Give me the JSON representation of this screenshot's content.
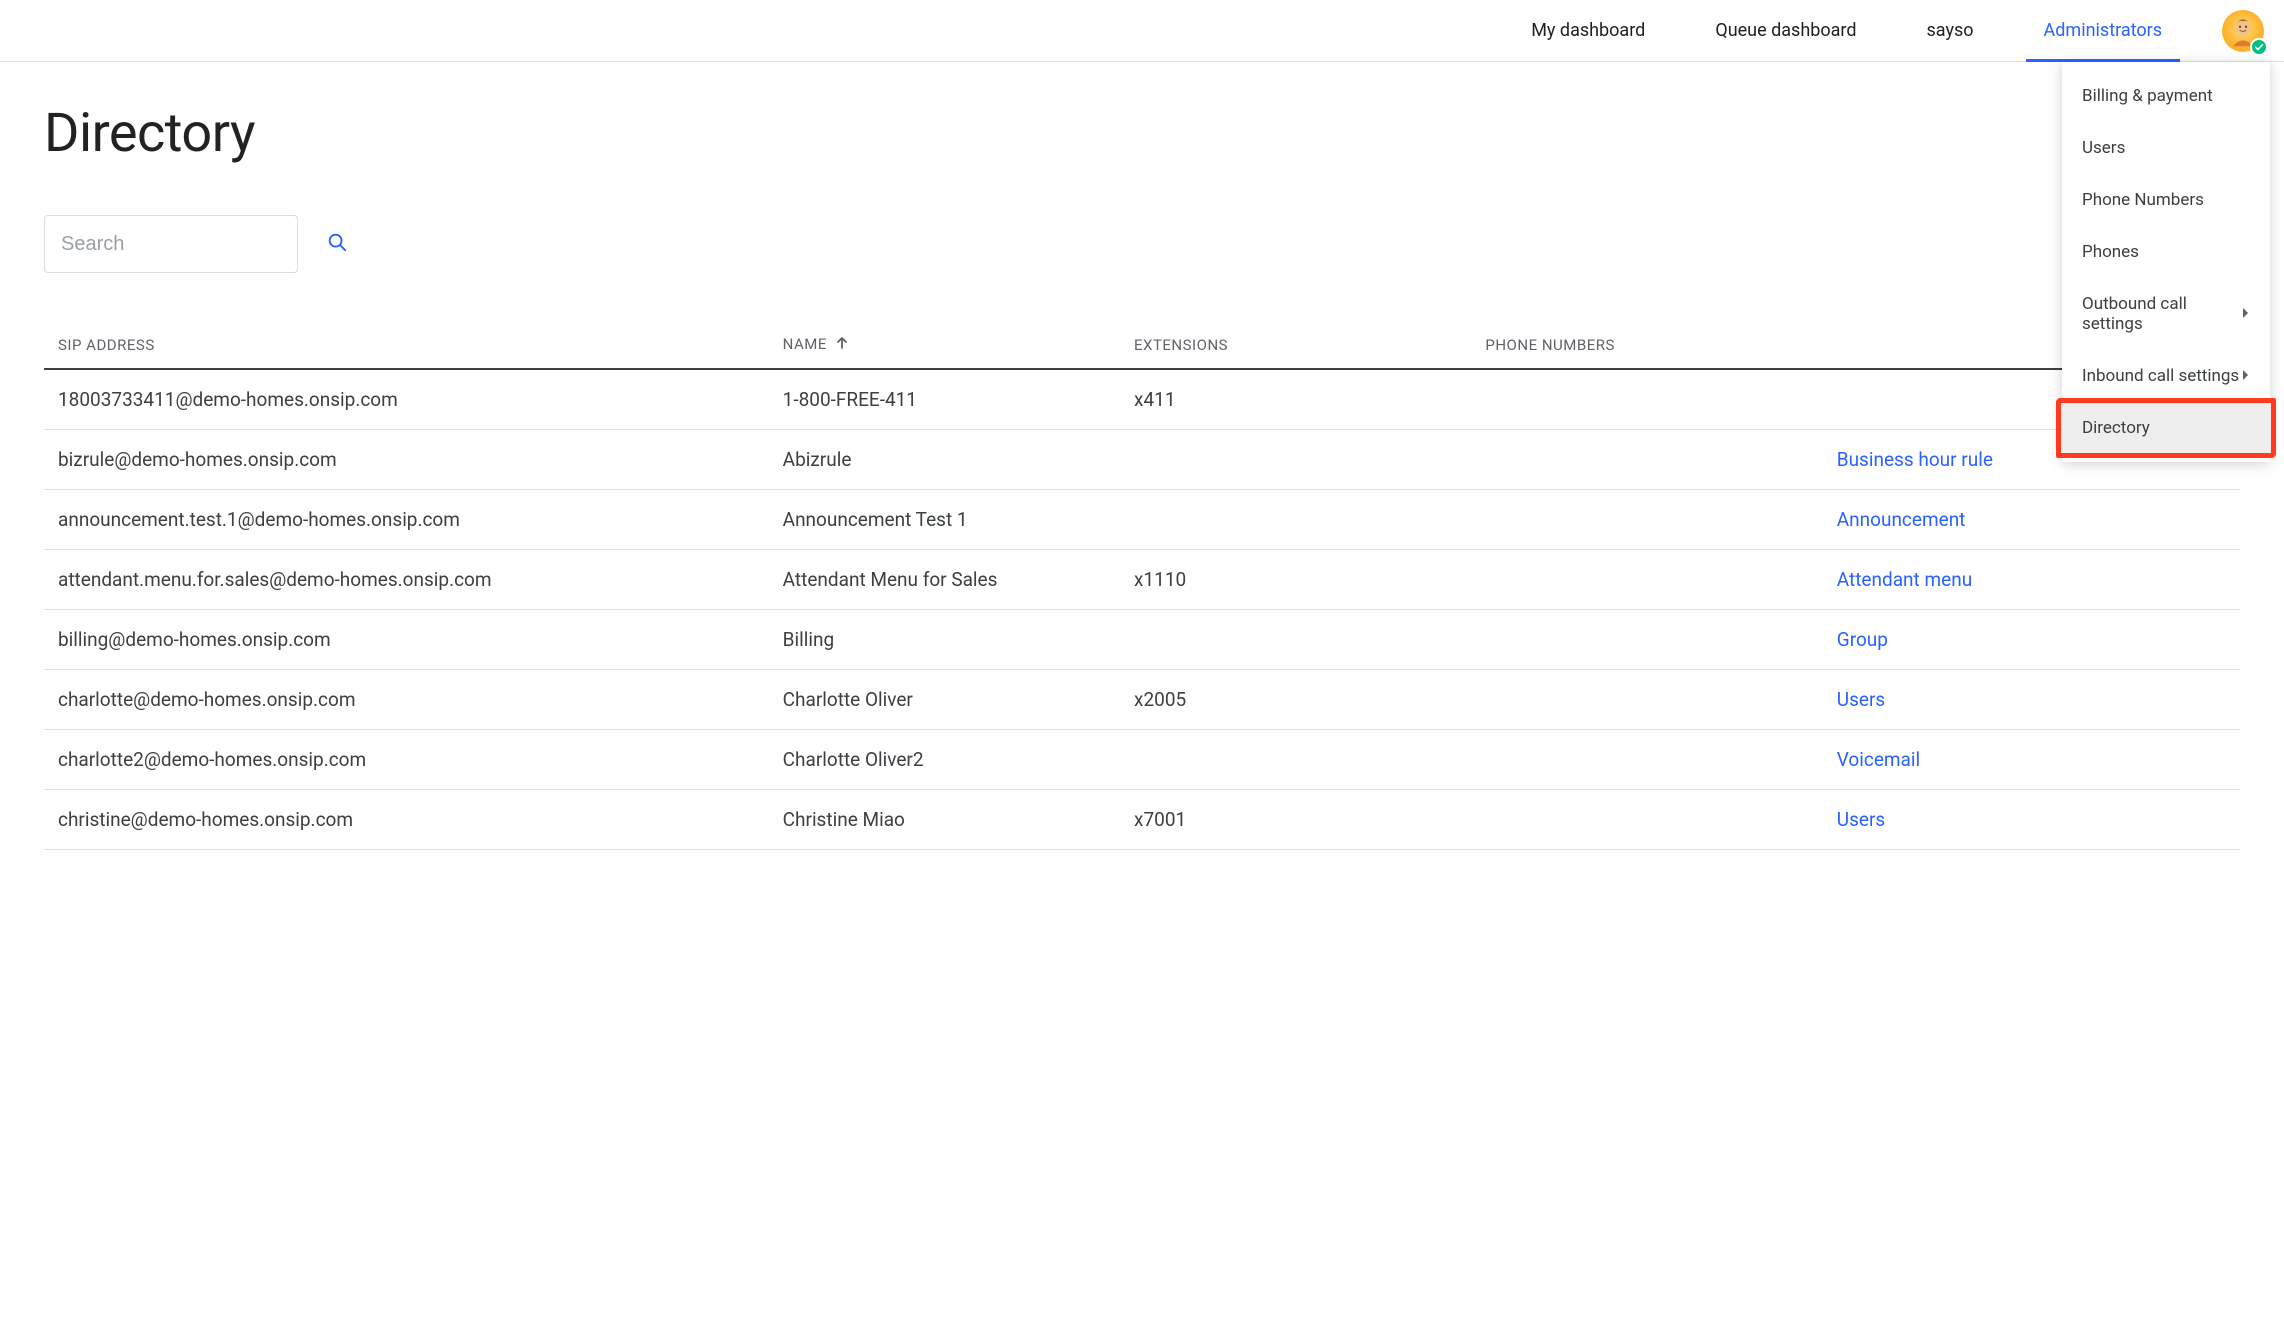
{
  "nav": {
    "items": [
      {
        "label": "My dashboard",
        "active": false
      },
      {
        "label": "Queue dashboard",
        "active": false
      },
      {
        "label": "sayso",
        "active": false
      },
      {
        "label": "Administrators",
        "active": true
      }
    ]
  },
  "dropdown": {
    "items": [
      {
        "label": "Billing & payment",
        "submenu": false
      },
      {
        "label": "Users",
        "submenu": false
      },
      {
        "label": "Phone Numbers",
        "submenu": false
      },
      {
        "label": "Phones",
        "submenu": false
      },
      {
        "label": "Outbound call settings",
        "submenu": true
      },
      {
        "label": "Inbound call settings",
        "submenu": true
      },
      {
        "label": "Directory",
        "submenu": false,
        "highlighted": true
      }
    ]
  },
  "page": {
    "title": "Directory"
  },
  "search": {
    "placeholder": "Search"
  },
  "table": {
    "columns": [
      {
        "label": "SIP ADDRESS"
      },
      {
        "label": "NAME",
        "sort": "asc"
      },
      {
        "label": "EXTENSIONS"
      },
      {
        "label": "PHONE NUMBERS"
      },
      {
        "label": ""
      }
    ],
    "rows": [
      {
        "sip": "18003733411@demo-homes.onsip.com",
        "name": "1-800-FREE-411",
        "ext": "x411",
        "phone": "",
        "app": ""
      },
      {
        "sip": "bizrule@demo-homes.onsip.com",
        "name": "Abizrule",
        "ext": "",
        "phone": "",
        "app": "Business hour rule"
      },
      {
        "sip": "announcement.test.1@demo-homes.onsip.com",
        "name": "Announcement Test 1",
        "ext": "",
        "phone": "",
        "app": "Announcement"
      },
      {
        "sip": "attendant.menu.for.sales@demo-homes.onsip.com",
        "name": "Attendant Menu for Sales",
        "ext": "x1110",
        "phone": "",
        "app": "Attendant menu"
      },
      {
        "sip": "billing@demo-homes.onsip.com",
        "name": "Billing",
        "ext": "",
        "phone": "",
        "app": "Group"
      },
      {
        "sip": "charlotte@demo-homes.onsip.com",
        "name": "Charlotte Oliver",
        "ext": "x2005",
        "phone": "",
        "app": "Users"
      },
      {
        "sip": "charlotte2@demo-homes.onsip.com",
        "name": "Charlotte Oliver2",
        "ext": "",
        "phone": "",
        "app": "Voicemail"
      },
      {
        "sip": "christine@demo-homes.onsip.com",
        "name": "Christine Miao",
        "ext": "x7001",
        "phone": "",
        "app": "Users"
      }
    ]
  }
}
